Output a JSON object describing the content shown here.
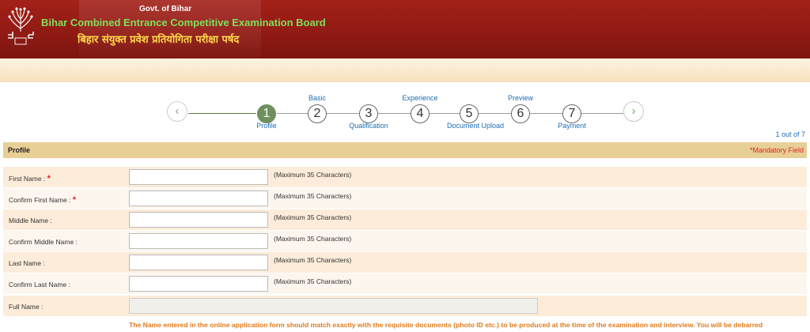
{
  "header": {
    "govt": "Govt. of Bihar",
    "board": "Bihar Combined Entrance Competitive Examination Board",
    "hindi": "बिहार संयुक्त प्रवेश प्रतियोगिता परीक्षा पर्षद",
    "colors": {
      "banner": "#8f1a14",
      "board_text": "#7ee05a",
      "hindi_text": "#ffd84a"
    }
  },
  "stepper": {
    "prev_glyph": "‹",
    "next_glyph": "›",
    "steps": [
      {
        "number": "1",
        "label": "Profile",
        "label_pos": "below",
        "active": true
      },
      {
        "number": "2",
        "label": "Basic",
        "label_pos": "above"
      },
      {
        "number": "3",
        "label": "Qualification",
        "label_pos": "below"
      },
      {
        "number": "4",
        "label": "Experience",
        "label_pos": "above"
      },
      {
        "number": "5",
        "label": "Document Upload",
        "label_pos": "below"
      },
      {
        "number": "6",
        "label": "Preview",
        "label_pos": "above"
      },
      {
        "number": "7",
        "label": "Payment",
        "label_pos": "below"
      }
    ],
    "counter": "1 out of 7"
  },
  "section": {
    "title": "Profile",
    "mandatory": "*Mandatory Field"
  },
  "form": {
    "rows": [
      {
        "label": "First Name : ",
        "required": true,
        "value": "",
        "hint": "(Maximum 35 Characters)"
      },
      {
        "label": "Confirm First Name : ",
        "required": true,
        "value": "",
        "hint": "(Maximum 35 Characters)"
      },
      {
        "label": "Middle Name :",
        "required": false,
        "value": "",
        "hint": "(Maximum 35 Characters)"
      },
      {
        "label": "Confirm Middle Name :",
        "required": false,
        "value": "",
        "hint": "(Maximum 35 Characters)"
      },
      {
        "label": "Last Name :",
        "required": false,
        "value": "",
        "hint": "(Maximum 35 Characters)"
      },
      {
        "label": "Confirm Last Name :",
        "required": false,
        "value": "",
        "hint": "(Maximum 35 Characters)"
      }
    ],
    "full_name": {
      "label": "Full Name :",
      "value": ""
    },
    "warning": "The Name entered in the online application form should match exactly with the requisite documents (photo ID etc.) to be produced at the time of the examination and interview. You will be debarred"
  }
}
